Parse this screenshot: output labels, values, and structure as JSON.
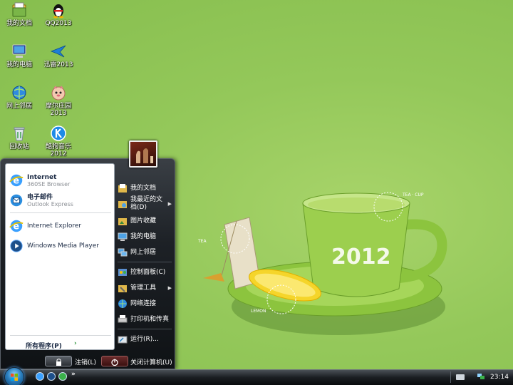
{
  "desktop": {
    "icons": [
      {
        "name": "my-documents",
        "label": "我的文档"
      },
      {
        "name": "qq",
        "label": "QQ2013"
      },
      {
        "name": "my-computer",
        "label": "我的电脑"
      },
      {
        "name": "xunlei",
        "label": "迅雷2013"
      },
      {
        "name": "network-neighborhood",
        "label": "网上邻居"
      },
      {
        "name": "mole-manor",
        "label": "摩尔庄园",
        "label2": "2013"
      },
      {
        "name": "recycle-bin",
        "label": "回收站"
      },
      {
        "name": "kugou",
        "label": "酷狗音乐",
        "label2": "2012"
      }
    ]
  },
  "wallpaper": {
    "cup_text": "2012",
    "tag_cup": "TEA · CUP",
    "tag_tea": "TEA",
    "tag_lemon": "LEMON",
    "colors": {
      "background": "#94c85a",
      "cup": "#9ccf4e",
      "lemon": "#f5d52a"
    }
  },
  "start_menu": {
    "pinned": [
      {
        "title": "Internet",
        "subtitle": "360SE Browser"
      },
      {
        "title": "电子邮件",
        "subtitle": "Outlook Express"
      }
    ],
    "recent": [
      {
        "title": "Internet Explorer"
      },
      {
        "title": "Windows Media Player"
      }
    ],
    "all_programs": "所有程序(P)",
    "right": [
      {
        "label": "我的文档"
      },
      {
        "label": "我最近的文档(D)",
        "line1": "我最近的文",
        "line2": "档(D)",
        "submenu": true
      },
      {
        "label": "图片收藏"
      },
      {
        "label": "我的电脑"
      },
      {
        "label": "网上邻居"
      },
      {
        "label": "控制面板(C)"
      },
      {
        "label": "管理工具",
        "submenu": true
      },
      {
        "label": "网络连接"
      },
      {
        "label": "打印机和传真"
      },
      {
        "label": "运行(R)..."
      }
    ],
    "logoff": "注销(L)",
    "shutdown": "关闭计算机(U)"
  },
  "taskbar": {
    "more": "»",
    "clock": "23:14"
  }
}
